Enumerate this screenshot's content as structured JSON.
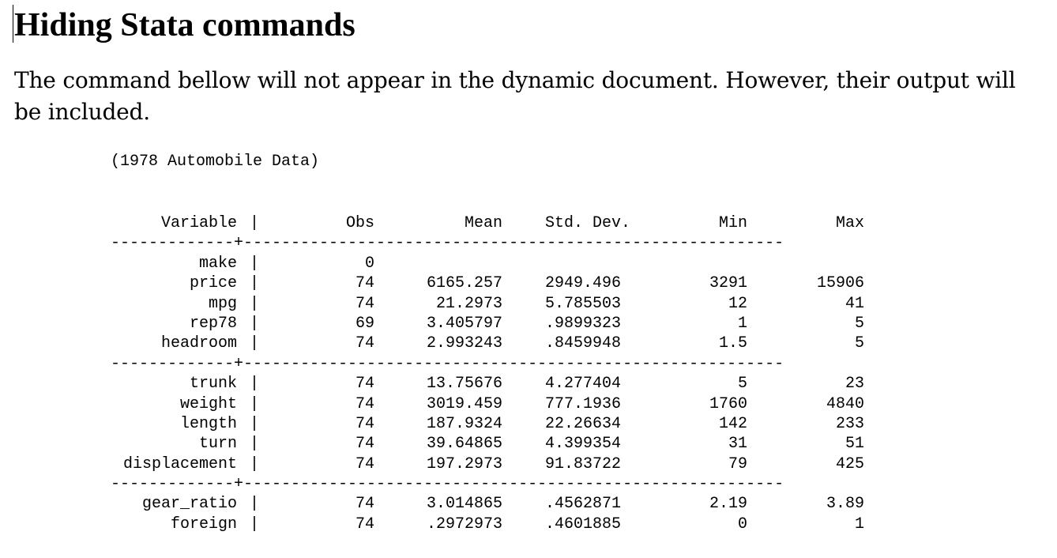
{
  "heading": "Hiding Stata commands",
  "intro": "The command bellow will not appear in the dynamic document. However, their output will be included.",
  "dataset_line": "(1978 Automobile Data)",
  "table": {
    "headers": {
      "variable": "Variable",
      "obs": "Obs",
      "mean": "Mean",
      "sd": "Std. Dev.",
      "min": "Min",
      "max": "Max"
    },
    "separator": "-------------+---------------------------------------------------------",
    "bar": "|",
    "groups": [
      [
        {
          "var": "make",
          "obs": "0",
          "mean": "",
          "sd": "",
          "min": "",
          "max": ""
        },
        {
          "var": "price",
          "obs": "74",
          "mean": "6165.257",
          "sd": "2949.496",
          "min": "3291",
          "max": "15906"
        },
        {
          "var": "mpg",
          "obs": "74",
          "mean": "21.2973",
          "sd": "5.785503",
          "min": "12",
          "max": "41"
        },
        {
          "var": "rep78",
          "obs": "69",
          "mean": "3.405797",
          "sd": ".9899323",
          "min": "1",
          "max": "5"
        },
        {
          "var": "headroom",
          "obs": "74",
          "mean": "2.993243",
          "sd": ".8459948",
          "min": "1.5",
          "max": "5"
        }
      ],
      [
        {
          "var": "trunk",
          "obs": "74",
          "mean": "13.75676",
          "sd": "4.277404",
          "min": "5",
          "max": "23"
        },
        {
          "var": "weight",
          "obs": "74",
          "mean": "3019.459",
          "sd": "777.1936",
          "min": "1760",
          "max": "4840"
        },
        {
          "var": "length",
          "obs": "74",
          "mean": "187.9324",
          "sd": "22.26634",
          "min": "142",
          "max": "233"
        },
        {
          "var": "turn",
          "obs": "74",
          "mean": "39.64865",
          "sd": "4.399354",
          "min": "31",
          "max": "51"
        },
        {
          "var": "displacement",
          "obs": "74",
          "mean": "197.2973",
          "sd": "91.83722",
          "min": "79",
          "max": "425"
        }
      ],
      [
        {
          "var": "gear_ratio",
          "obs": "74",
          "mean": "3.014865",
          "sd": ".4562871",
          "min": "2.19",
          "max": "3.89"
        },
        {
          "var": "foreign",
          "obs": "74",
          "mean": ".2972973",
          "sd": ".4601885",
          "min": "0",
          "max": "1"
        }
      ]
    ]
  }
}
